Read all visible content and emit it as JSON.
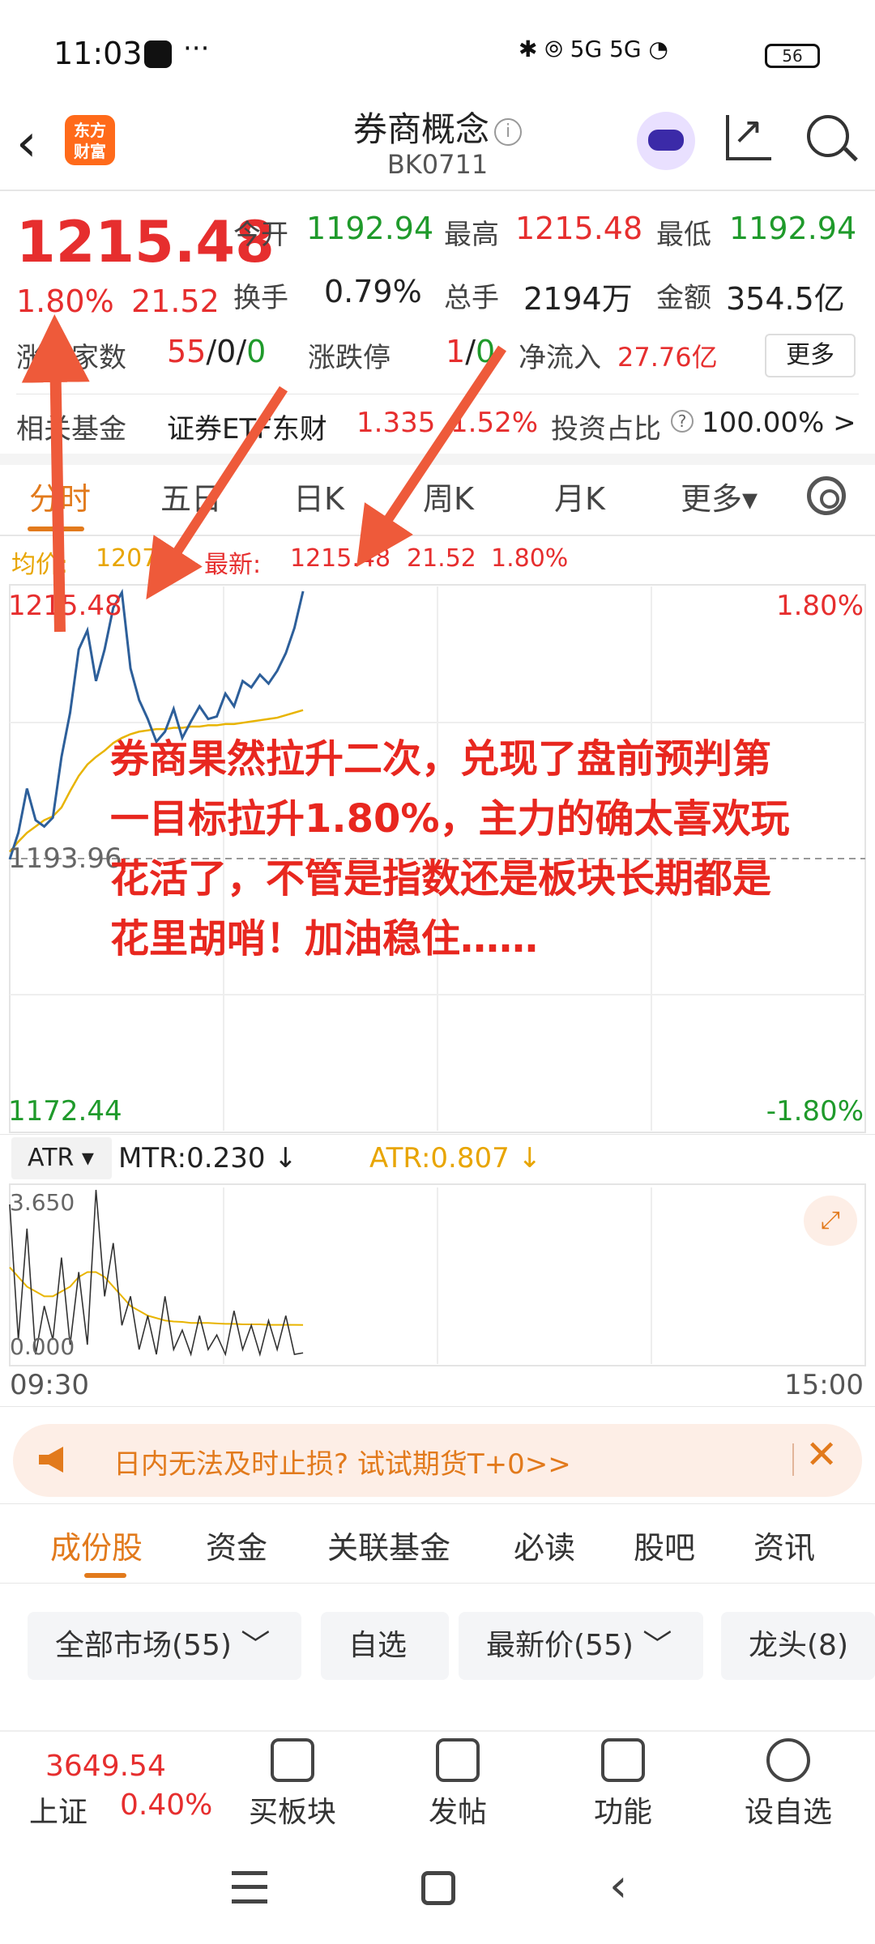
{
  "status_bar": {
    "time": "11:03",
    "more": "···",
    "network": "5G 5G",
    "battery": "56"
  },
  "header": {
    "logo_line1": "东方",
    "logo_line2": "财富",
    "title": "券商概念",
    "code": "BK0711",
    "info_icon": "i"
  },
  "quote": {
    "price": "1215.48",
    "change_pct": "1.80%",
    "change_amt": "21.52",
    "open_label": "今开",
    "open": "1192.94",
    "high_label": "最高",
    "high": "1215.48",
    "low_label": "最低",
    "low": "1192.94",
    "turnover_label": "换手",
    "turnover": "0.79%",
    "volume_label": "总手",
    "volume": "2194万",
    "amount_label": "金额",
    "amount": "354.5亿",
    "updown_label": "涨跌家数",
    "up": "55",
    "flat": "0",
    "down": "0",
    "limit_label": "涨跌停",
    "limit_up": "1",
    "limit_down": "0",
    "netflow_label": "净流入",
    "netflow": "27.76亿",
    "more_label": "更多",
    "fund_label": "相关基金",
    "fund_name": "证券ETF东财",
    "fund_price": "1.335",
    "fund_pct": "1.52%",
    "ratio_label": "投资占比",
    "ratio_value": "100.00% >"
  },
  "chart_tabs": [
    "分时",
    "五日",
    "日K",
    "周K",
    "月K",
    "更多▾"
  ],
  "chart_info": {
    "avg_label": "均价:",
    "avg_value": "1207.5",
    "latest_label": "最新:",
    "latest_value": "1215.48",
    "latest_chg": "21.52",
    "latest_pct": "1.80%"
  },
  "chart_axes": {
    "y_top": "1215.48",
    "y_mid": "1193.96",
    "y_bottom": "1172.44",
    "pct_top": "1.80%",
    "pct_bottom": "-1.80%"
  },
  "annotation": "券商果然拉升二次，兑现了盘前预判第一目标拉升1.80%，主力的确太喜欢玩花活了，不管是指数还是板块长期都是花里胡哨！加油稳住……",
  "atr": {
    "select": "ATR ▾",
    "mtr": "MTR:0.230 ↓",
    "atr_value": "ATR:0.807 ↓",
    "y_top": "3.650",
    "y_bottom": "0.000"
  },
  "time_axis": {
    "start": "09:30",
    "end": "15:00"
  },
  "banner": {
    "text": "日内无法及时止损? 试试期货T+0>>",
    "close": "✕"
  },
  "bottom_tabs": [
    "成份股",
    "资金",
    "关联基金",
    "必读",
    "股吧",
    "资讯"
  ],
  "filters": [
    "全部市场(55) ﹀",
    "自选",
    "最新价(55) ﹀",
    "龙头(8)"
  ],
  "footer": {
    "index_price": "3649.54",
    "index_name": "上证",
    "index_pct": "0.40%",
    "items": [
      "买板块",
      "发帖",
      "功能",
      "设自选"
    ]
  },
  "colors": {
    "up": "#e62e2e",
    "down": "#1f9a2b",
    "accent": "#e27a1c",
    "avg_line": "#e8b400",
    "price_line": "#2d5f9a"
  },
  "chart_data": [
    {
      "type": "line",
      "series": [
        {
          "name": "最新",
          "values": [
            1193.9,
            1196.0,
            1199.5,
            1197.0,
            1196.5,
            1197.2,
            1202.0,
            1205.5,
            1210.5,
            1212.0,
            1208.0,
            1210.5,
            1213.8,
            1215.0,
            1209.0,
            1206.5,
            1205.0,
            1203.2,
            1204.0,
            1205.8,
            1203.5,
            1204.8,
            1206.0,
            1205.0,
            1205.2,
            1207.0,
            1206.0,
            1208.0,
            1207.5,
            1208.5,
            1207.8,
            1208.8,
            1210.2,
            1212.2,
            1215.1
          ]
        },
        {
          "name": "均价",
          "values": [
            1194.5,
            1195.3,
            1196.0,
            1196.5,
            1197.0,
            1197.3,
            1198.0,
            1199.3,
            1200.5,
            1201.4,
            1202.0,
            1202.5,
            1203.1,
            1203.5,
            1203.8,
            1204.0,
            1204.1,
            1204.2,
            1204.2,
            1204.3,
            1204.3,
            1204.4,
            1204.4,
            1204.5,
            1204.5,
            1204.6,
            1204.6,
            1204.7,
            1204.8,
            1204.9,
            1205.0,
            1205.1,
            1205.3,
            1205.5,
            1205.7
          ]
        }
      ],
      "ylim": [
        1172.44,
        1215.48
      ]
    },
    {
      "type": "line",
      "series": [
        {
          "name": "MTR",
          "values": [
            3.3,
            0.5,
            2.8,
            0.2,
            1.2,
            0.5,
            2.2,
            0.4,
            1.9,
            0.4,
            3.6,
            1.4,
            2.5,
            0.8,
            1.4,
            0.3,
            1.0,
            0.2,
            1.4,
            0.3,
            0.7,
            0.2,
            1.0,
            0.3,
            0.6,
            0.2,
            1.1,
            0.3,
            0.8,
            0.2,
            0.9,
            0.3,
            1.0,
            0.2,
            0.23
          ]
        },
        {
          "name": "ATR",
          "values": [
            2.0,
            1.8,
            1.6,
            1.5,
            1.4,
            1.4,
            1.5,
            1.6,
            1.8,
            1.9,
            1.9,
            1.8,
            1.6,
            1.4,
            1.2,
            1.1,
            1.0,
            0.95,
            0.9,
            0.88,
            0.87,
            0.85,
            0.85,
            0.85,
            0.84,
            0.83,
            0.83,
            0.82,
            0.82,
            0.82,
            0.81,
            0.81,
            0.81,
            0.81,
            0.807
          ]
        }
      ],
      "ylim": [
        0,
        3.65
      ]
    }
  ]
}
